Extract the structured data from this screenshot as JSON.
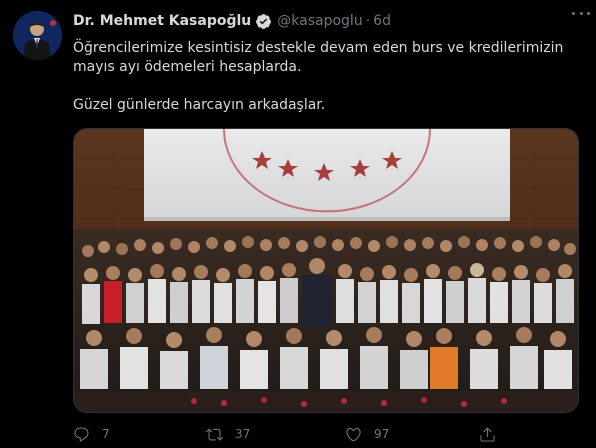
{
  "tweet": {
    "author_name": "Dr. Mehmet Kasapoğlu",
    "handle": "@kasapoglu",
    "separator": "·",
    "time": "6d",
    "text_line_1": "Öğrencilerimize kesintisiz destekle devam eden burs ve kredilerimizin mayıs ayı ödemeleri hesaplarda.",
    "text_line_2": "Güzel günlerde harcayın arkadaşlar.",
    "verified": true
  },
  "actions": {
    "reply_count": "7",
    "retweet_count": "37",
    "like_count": "97"
  },
  "colors": {
    "background": "#000000",
    "text": "#d9d9d9",
    "secondary": "#6e767d",
    "verified": "#d9d9d9"
  },
  "icons": {
    "verified": "verified-badge-icon",
    "more": "more-icon",
    "reply": "reply-icon",
    "retweet": "retweet-icon",
    "like": "like-icon",
    "share": "share-icon"
  }
}
